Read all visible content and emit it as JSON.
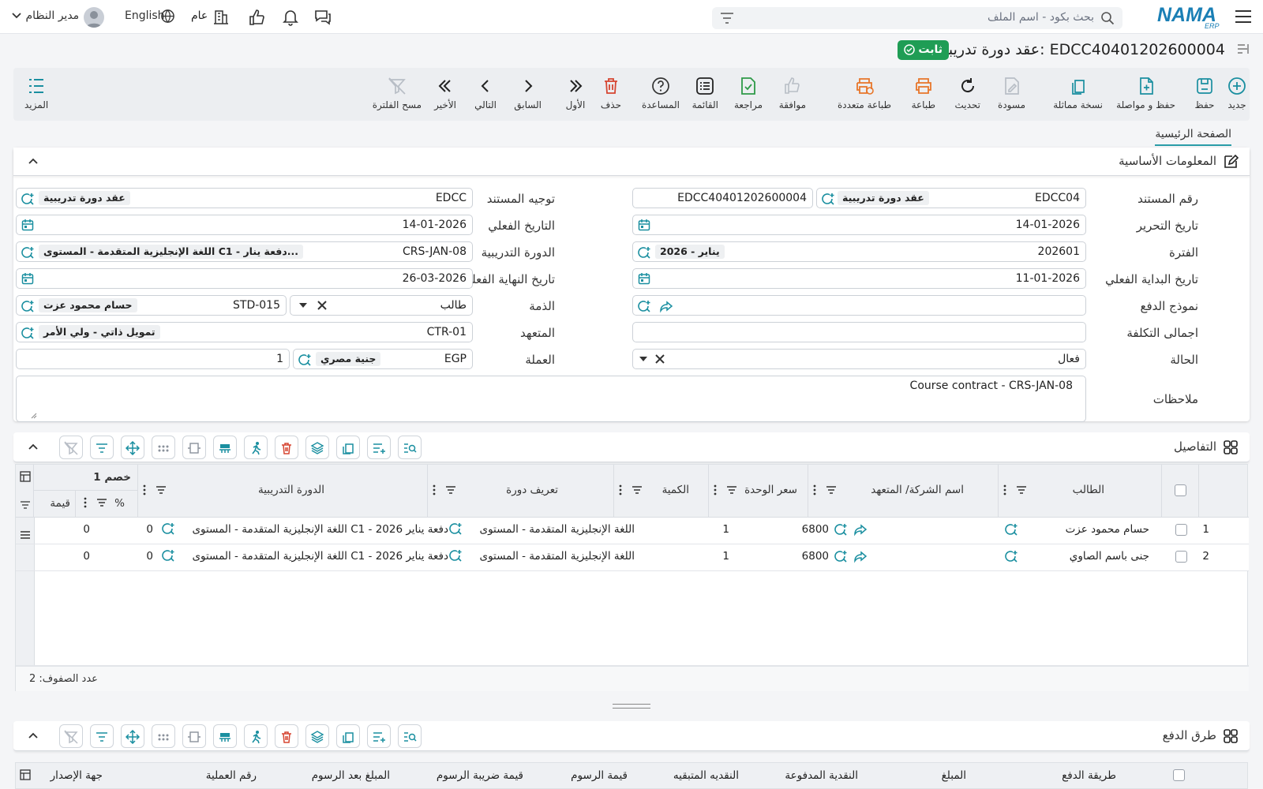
{
  "app": {
    "logo": "NAMA",
    "logo_sub": "ERP"
  },
  "topbar": {
    "search_placeholder": "بحث بكود - اسم الملف",
    "general_label": "عام",
    "language": "English",
    "user": "مدير النظام"
  },
  "page": {
    "title": "عقد دورة تدريبية: EDCC40401202600004",
    "status_badge": "ثابت",
    "home_tab": "الصفحة الرئيسية"
  },
  "toolbar": {
    "new": "جديد",
    "save": "حفظ",
    "save_continue": "حفظ و مواصلة",
    "duplicate": "نسخة مماثلة",
    "draft": "مسودة",
    "refresh": "تحديث",
    "print": "طباعة",
    "multi_print": "طباعة متعددة",
    "approve": "موافقة",
    "review": "مراجعة",
    "list": "القائمة",
    "help": "المساعدة",
    "delete": "حذف",
    "first": "الأول",
    "previous": "السابق",
    "next": "التالي",
    "last": "الأخير",
    "clear_filter": "مسح الفلترة",
    "more": "المزيد"
  },
  "basic_section": {
    "title": "المعلومات الأساسية"
  },
  "form": {
    "doc_number": {
      "label": "رقم المستند",
      "code": "EDCC04",
      "name": "عقد دورة تدريبية",
      "number": "EDCC40401202600004"
    },
    "issue_date": {
      "label": "تاريخ التحرير",
      "value": "14-01-2026"
    },
    "period": {
      "label": "الفترة",
      "code": "202601",
      "name": "2026 - يناير"
    },
    "actual_start": {
      "label": "تاريخ البداية الفعلي",
      "value": "11-01-2026"
    },
    "payment_model": {
      "label": "نموذج الدفع",
      "value": ""
    },
    "total_cost": {
      "label": "اجمالى التكلفة",
      "value": ""
    },
    "status": {
      "label": "الحالة",
      "value": "فعال"
    },
    "doc_direction": {
      "label": "توجيه المستند",
      "code": "EDCC",
      "name": "عقد دورة تدريبية"
    },
    "actual_date": {
      "label": "التاريخ الفعلي",
      "value": "14-01-2026"
    },
    "course": {
      "label": "الدورة التدريبية",
      "code": "CRS-JAN-08",
      "name": "اللغة الإنجليزية المتقدمة - المستوى C1 - دفعة ينار..."
    },
    "actual_end": {
      "label": "تاريخ النهاية الفعلي",
      "value": "26-03-2026"
    },
    "liability": {
      "label": "الذمة",
      "type": "طالب",
      "code": "STD-015",
      "name": "حسام محمود عزت"
    },
    "contractor": {
      "label": "المتعهد",
      "code": "CTR-01",
      "name": "تمويل ذاتي - ولي الأمر"
    },
    "currency": {
      "label": "العملة",
      "code": "EGP",
      "name": "جنية مصري",
      "rate": "1"
    },
    "notes": {
      "label": "ملاحظات",
      "value": "Course contract - CRS-JAN-08"
    }
  },
  "details": {
    "title": "التفاصيل",
    "columns": {
      "student": "الطالب",
      "company": "اسم الشركة/ المتعهد",
      "unit_price": "سعر الوحدة",
      "qty": "الكمية",
      "course_def": "تعريف دورة",
      "course": "الدورة التدريبية",
      "discount": "خصم 1",
      "pct": "%",
      "value": "قيمة"
    },
    "rows": [
      {
        "no": "1",
        "student": "حسام محمود عزت",
        "unit_price": "6800",
        "qty": "1",
        "course_def": "اللغة الإنجليزية المتقدمة - المستوى",
        "course": "اللغة الإنجليزية المتقدمة - المستوى C1 - دفعة يناير 2026",
        "pct": "0",
        "value": "0"
      },
      {
        "no": "2",
        "student": "جنى باسم الصاوي",
        "unit_price": "6800",
        "qty": "1",
        "course_def": "اللغة الإنجليزية المتقدمة - المستوى",
        "course": "اللغة الإنجليزية المتقدمة - المستوى C1 - دفعة يناير 2026",
        "pct": "0",
        "value": "0"
      }
    ],
    "row_count": "عدد الصفوف: 2"
  },
  "payments": {
    "title": "طرق الدفع",
    "columns": [
      "طريقة الدفع",
      "المبلغ",
      "النقدية المدفوعة",
      "النقديه المتبقيه",
      "قيمة الرسوم",
      "قيمة ضريبة الرسوم",
      "المبلغ بعد الرسوم",
      "رقم العملية",
      "جهة الإصدار"
    ]
  },
  "colors": {
    "accent": "#1a8fa0",
    "status_green": "#1f9d55",
    "delete_red": "#d64531",
    "print_orange": "#e8762a"
  }
}
